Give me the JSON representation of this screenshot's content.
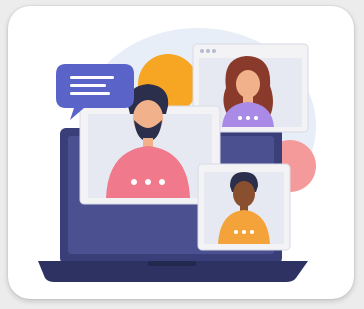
{
  "card": {
    "illustration": "video-conference-illustration"
  },
  "colors": {
    "background": "#ececec",
    "card": "#ffffff",
    "blob_light": "#e8eef8",
    "blob_orange": "#f6a623",
    "blob_pink": "#f59a9a",
    "laptop_body": "#3a3f7a",
    "laptop_base": "#2d3263",
    "window_frame": "#f3f3f6",
    "window_screen": "#e7e9f2",
    "bubble": "#5a64c8",
    "man_shirt": "#f07a8c",
    "woman_shirt": "#a98ae6",
    "boy_shirt": "#f3a33a",
    "skin_light": "#f1b18b",
    "skin_dark": "#8a4f2e",
    "hair_dark": "#2b2f4b",
    "hair_woman": "#8a3a2a"
  }
}
